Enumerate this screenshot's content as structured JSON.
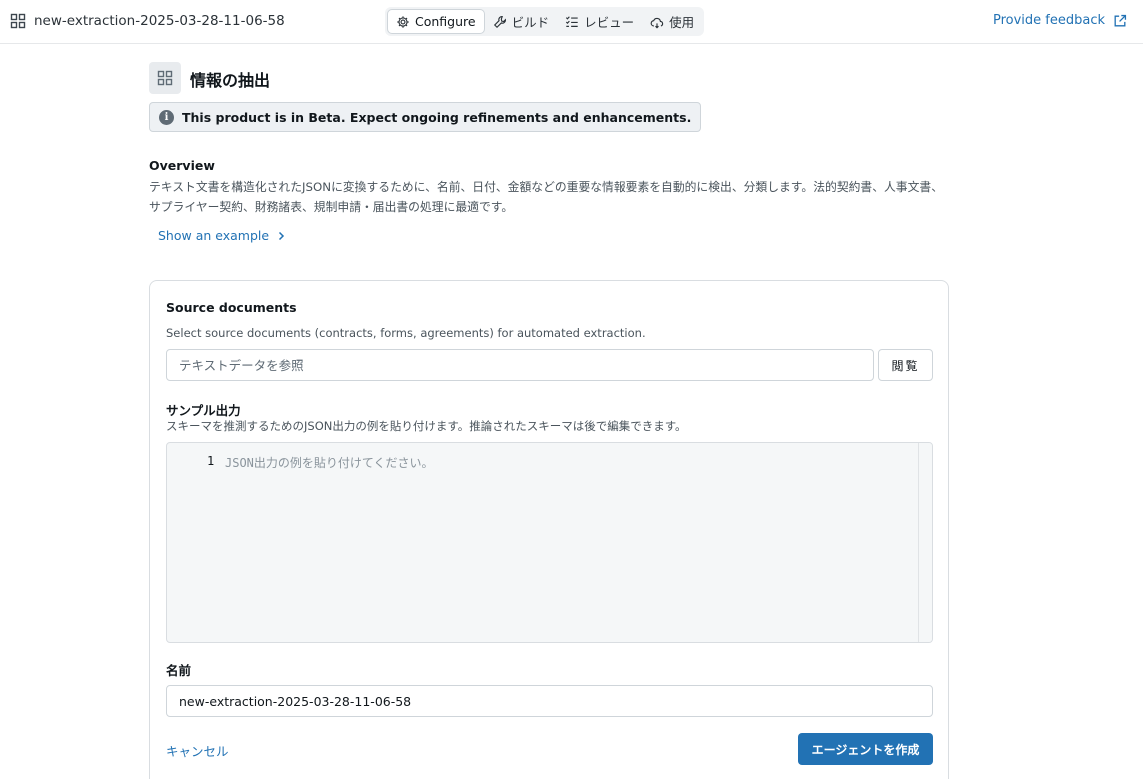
{
  "header": {
    "app_icon": "grid-icon",
    "title": "new-extraction-2025-03-28-11-06-58",
    "tabs": [
      {
        "label": "Configure",
        "icon": "gear-icon",
        "active": true
      },
      {
        "label": "ビルド",
        "icon": "wrench-icon",
        "active": false
      },
      {
        "label": "レビュー",
        "icon": "checklist-icon",
        "active": false
      },
      {
        "label": "使用",
        "icon": "cloud-sync-icon",
        "active": false
      }
    ],
    "feedback_label": "Provide feedback",
    "feedback_icon": "external-link-icon"
  },
  "page": {
    "icon": "grid-icon",
    "title": "情報の抽出",
    "beta_notice": "This product is in Beta. Expect ongoing refinements and enhancements.",
    "overview_heading": "Overview",
    "overview_text": "テキスト文書を構造化されたJSONに変換するために、名前、日付、金額などの重要な情報要素を自動的に検出、分類します。法的契約書、人事文書、サプライヤー契約、財務諸表、規制申請・届出書の処理に最適です。",
    "example_link": "Show an example"
  },
  "form": {
    "source_label": "Source documents",
    "source_hint": "Select source documents (contracts, forms, agreements) for automated extraction.",
    "source_placeholder": "テキストデータを参照",
    "browse_label": "閲覧",
    "sample_label": "サンプル出力",
    "sample_hint": "スキーマを推測するためのJSON出力の例を貼り付けます。推論されたスキーマは後で編集できます。",
    "editor_line_number": "1",
    "editor_placeholder": "JSON出力の例を貼り付けてください。",
    "name_label": "名前",
    "name_value": "new-extraction-2025-03-28-11-06-58",
    "cancel_label": "キャンセル",
    "create_label": "エージェントを作成"
  },
  "colors": {
    "accent": "#2272b4",
    "border": "#cfd5da",
    "text": "#11171c",
    "muted_text": "#4a545c"
  }
}
